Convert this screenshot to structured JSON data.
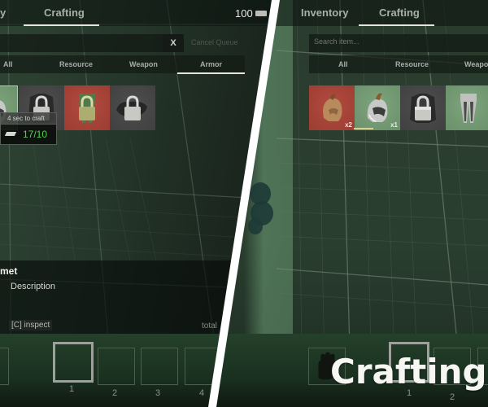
{
  "left_panel": {
    "tabs": [
      {
        "label": "Inventory",
        "visible_text": "y",
        "active": false
      },
      {
        "label": "Crafting",
        "active": true
      }
    ],
    "battery": {
      "value": "100",
      "icon": "battery-icon"
    },
    "search": {
      "placeholder": "",
      "value": ""
    },
    "cancel_queue": {
      "x_label": "X",
      "label": "Cancel Queue"
    },
    "filters": [
      {
        "label": "All",
        "active": false
      },
      {
        "label": "Resource",
        "active": false
      },
      {
        "label": "Weapon",
        "active": false
      },
      {
        "label": "Armor",
        "active": true
      }
    ],
    "items": [
      {
        "name": "helmet",
        "bg": "green",
        "locked": false,
        "selected": true
      },
      {
        "name": "chestplate",
        "bg": "gray",
        "locked": true
      },
      {
        "name": "leggings",
        "bg": "red",
        "locked": true
      },
      {
        "name": "gloves",
        "bg": "gray",
        "locked": true
      }
    ],
    "tooltip": {
      "time": "4 sec to craft",
      "resource_icon": "ingot-icon",
      "count": "17/10"
    },
    "description": {
      "item_name": "met",
      "description": "Description",
      "inspect": "[C] inspect",
      "total": "total"
    },
    "hotbar": {
      "slots": [
        "",
        "1",
        "2",
        "3",
        "4"
      ]
    }
  },
  "right_panel": {
    "tabs": [
      {
        "label": "Inventory",
        "active": false
      },
      {
        "label": "Crafting",
        "active": true
      }
    ],
    "search": {
      "placeholder": "Search item...",
      "value": ""
    },
    "filters": [
      {
        "label": "All"
      },
      {
        "label": "Resource"
      },
      {
        "label": "Weapo"
      }
    ],
    "items": [
      {
        "name": "leather-helmet",
        "bg": "red",
        "qty": "x2"
      },
      {
        "name": "steel-helmet",
        "bg": "green",
        "qty": "x1",
        "progress": 0.45
      },
      {
        "name": "chestplate",
        "bg": "gray",
        "locked": true
      },
      {
        "name": "leggings",
        "bg": "green",
        "locked": false
      }
    ],
    "hotbar": {
      "slots": [
        "",
        "1",
        "2"
      ],
      "first_slot_icon": "glove-icon"
    }
  },
  "overlay_title": "Crafting S",
  "colors": {
    "accent_underline": "#e4e6de",
    "count_green": "#55d154",
    "bg_red": "#a8443a",
    "bg_green": "#759b76",
    "bg_gray": "#474747",
    "progress": "#d9cf8a"
  }
}
